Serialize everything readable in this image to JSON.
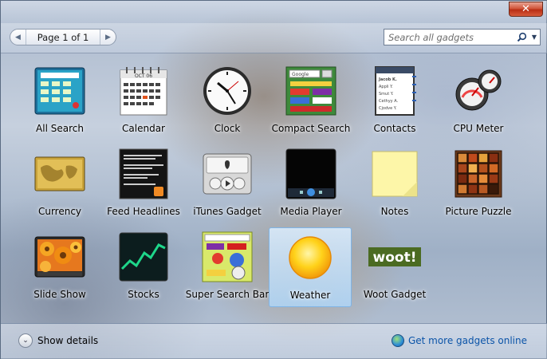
{
  "window": {
    "close_glyph": "✕"
  },
  "pager": {
    "label": "Page 1 of 1"
  },
  "search": {
    "placeholder": "Search all gadgets"
  },
  "gadgets": [
    {
      "label": "All Search",
      "icon": "all-search-icon"
    },
    {
      "label": "Calendar",
      "icon": "calendar-icon",
      "detail": "OCT 06"
    },
    {
      "label": "Clock",
      "icon": "clock-icon"
    },
    {
      "label": "Compact Search",
      "icon": "compact-search-icon",
      "detail": "Google"
    },
    {
      "label": "Contacts",
      "icon": "contacts-icon",
      "detail": [
        "Jacob K.",
        "Appli Y.",
        "Smut Y.",
        "Cethyy A.",
        "Cjodve Y."
      ]
    },
    {
      "label": "CPU Meter",
      "icon": "cpu-meter-icon"
    },
    {
      "label": "Currency",
      "icon": "currency-icon"
    },
    {
      "label": "Feed Headlines",
      "icon": "feed-headlines-icon"
    },
    {
      "label": "iTunes Gadget",
      "icon": "itunes-icon"
    },
    {
      "label": "Media Player",
      "icon": "media-player-icon"
    },
    {
      "label": "Notes",
      "icon": "notes-icon"
    },
    {
      "label": "Picture Puzzle",
      "icon": "picture-puzzle-icon"
    },
    {
      "label": "Slide Show",
      "icon": "slide-show-icon"
    },
    {
      "label": "Stocks",
      "icon": "stocks-icon"
    },
    {
      "label": "Super Search Bar",
      "icon": "super-search-bar-icon"
    },
    {
      "label": "Weather",
      "icon": "weather-icon",
      "selected": true
    },
    {
      "label": "Woot Gadget",
      "icon": "woot-icon",
      "detail": "woot!"
    }
  ],
  "footer": {
    "details_label": "Show details",
    "more_link": "Get more gadgets online"
  },
  "colors": {
    "link": "#0b54a8",
    "selection": "#afd7fa",
    "close": "#c9432a"
  }
}
